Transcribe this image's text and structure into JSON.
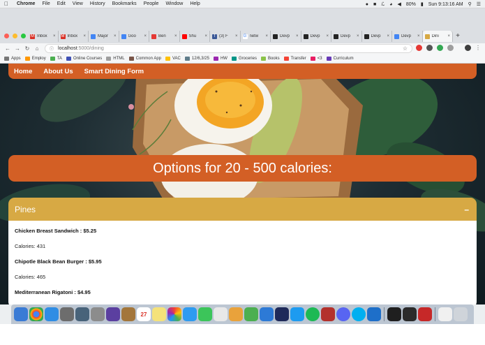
{
  "menubar": {
    "app": "Chrome",
    "menus": [
      "File",
      "Edit",
      "View",
      "History",
      "Bookmarks",
      "People",
      "Window",
      "Help"
    ],
    "battery": "80%",
    "clock": "Sun 9:13:16 AM"
  },
  "tabs": [
    {
      "title": "Inbox",
      "color": "#d93025",
      "glyph": "M"
    },
    {
      "title": "Inbox",
      "color": "#d93025",
      "glyph": "M"
    },
    {
      "title": "Major",
      "color": "#4285f4",
      "glyph": ""
    },
    {
      "title": "Goo",
      "color": "#4285f4",
      "glyph": ""
    },
    {
      "title": "Ben",
      "color": "#e53935",
      "glyph": ""
    },
    {
      "title": "Shu",
      "color": "#ff0000",
      "glyph": ""
    },
    {
      "title": "(3) F",
      "color": "#3b5998",
      "glyph": "f"
    },
    {
      "title": "netw",
      "color": "#ffffff",
      "glyph": "G"
    },
    {
      "title": "Devp",
      "color": "#222222",
      "glyph": ""
    },
    {
      "title": "Devp",
      "color": "#222222",
      "glyph": ""
    },
    {
      "title": "Devp",
      "color": "#222222",
      "glyph": ""
    },
    {
      "title": "Devp",
      "color": "#222222",
      "glyph": ""
    },
    {
      "title": "Devp",
      "color": "#4285f4",
      "glyph": ""
    },
    {
      "title": "Dini",
      "color": "#d7a944",
      "glyph": ""
    }
  ],
  "address": {
    "host": "localhost",
    "path": ":5000/dining"
  },
  "bookmarks": [
    "Apps",
    "Employ",
    "TA",
    "Online Courses",
    "HTML",
    "Common App",
    "VAC",
    "12/6,3/25",
    "HW",
    "Groceries",
    "Books",
    "Transfer",
    "<3",
    "Curriculum"
  ],
  "nav": {
    "home": "Home",
    "about": "About Us",
    "form": "Smart Dining Form"
  },
  "banner": "Options for 20 - 500 calories:",
  "accordion": {
    "title": "Pines",
    "toggle": "–",
    "items": [
      {
        "name": "Chicken Breast Sandwich : $5.25",
        "calories": "Calories: 431"
      },
      {
        "name": "Chipotle Black Bean Burger : $5.95",
        "calories": "Calories: 465"
      },
      {
        "name": "Mediterranean Rigatoni : $4.95",
        "calories": ""
      }
    ]
  },
  "dock": {
    "calendar_date": "27"
  }
}
